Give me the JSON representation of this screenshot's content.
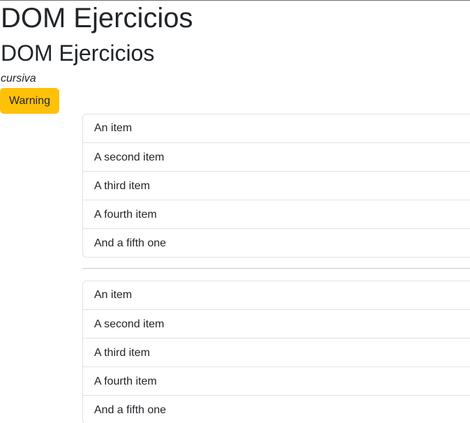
{
  "headings": {
    "h1": "DOM Ejercicios",
    "h2": "DOM Ejercicios"
  },
  "italic_text": "cursiva",
  "buttons": {
    "warning_label": "Warning"
  },
  "lists": [
    {
      "items": [
        "An item",
        "A second item",
        "A third item",
        "A fourth item",
        "And a fifth one"
      ]
    },
    {
      "items": [
        "An item",
        "A second item",
        "A third item",
        "A fourth item",
        "And a fifth one"
      ]
    }
  ],
  "colors": {
    "warning": "#ffc107",
    "border": "#dee2e6",
    "text": "#212529"
  }
}
